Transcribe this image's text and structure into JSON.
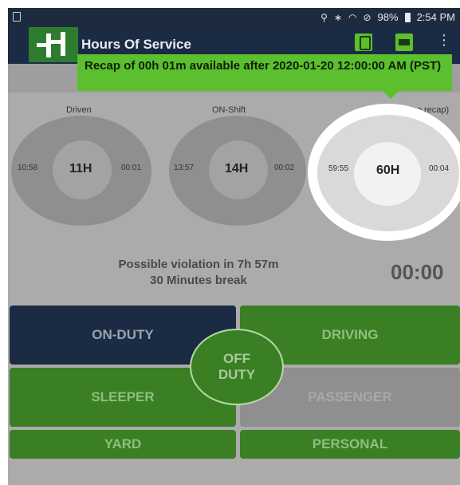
{
  "statusbar": {
    "right_text": "98%",
    "time": "2:54 PM"
  },
  "appbar": {
    "title": "Hours Of Service",
    "more": "⋮"
  },
  "tooltip": {
    "text": "Recap of 00h 01m available after 2020-01-20 12:00:00 AM (PST)"
  },
  "gauges": [
    {
      "label": "Driven",
      "center": "11H",
      "left": "10:58",
      "right": "00:01"
    },
    {
      "label": "ON-Shift",
      "center": "14H",
      "left": "13:57",
      "right": "00:02"
    },
    {
      "label": "ON-Cycle (See recap)",
      "center": "60H",
      "left": "59:55",
      "right": "00:04"
    }
  ],
  "violation": {
    "line1": "Possible violation in 7h 57m",
    "line2": "30 Minutes break"
  },
  "timer": "00:00",
  "duty_buttons": {
    "on_duty": "ON-DUTY",
    "driving": "DRIVING",
    "off_duty_line1": "OFF",
    "off_duty_line2": "DUTY",
    "sleeper": "SLEEPER",
    "passenger": "PASSENGER",
    "yard": "YARD",
    "personal": "PERSONAL"
  },
  "colors": {
    "appbar": "#1b2b44",
    "accent_green": "#5bbf2e",
    "duty_green": "#3a7f24",
    "dim_overlay": "#ababab"
  }
}
